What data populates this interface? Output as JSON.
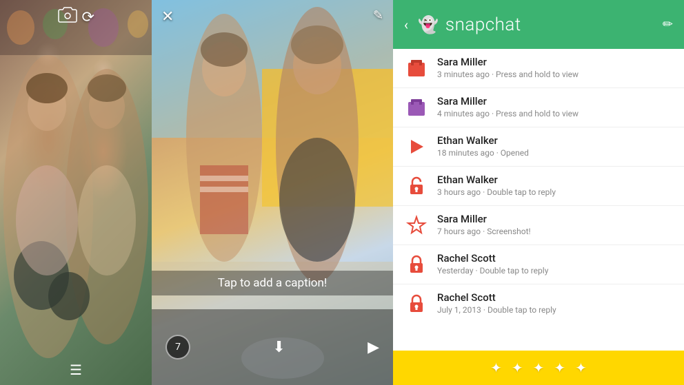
{
  "left_panel": {
    "top_icon": "📷",
    "bottom_icon": "☰"
  },
  "mid_panel": {
    "close_icon": "✕",
    "edit_icon": "✎",
    "caption": "Tap to add a caption!",
    "timer": "7",
    "download_icon": "⬇",
    "send_icon": "▶"
  },
  "right_panel": {
    "header": {
      "back": "‹",
      "ghost": "👻",
      "title": "snapchat",
      "compose": "✏"
    },
    "inbox": [
      {
        "icon": "📦",
        "icon_color": "#e74c3c",
        "name": "Sara Miller",
        "time": "3 minutes ago · Press and hold to view"
      },
      {
        "icon": "📦",
        "icon_color": "#9b59b6",
        "name": "Sara Miller",
        "time": "4 minutes ago · Press and hold to view"
      },
      {
        "icon": "▶",
        "icon_color": "#e74c3c",
        "name": "Ethan Walker",
        "time": "18 minutes ago · Opened"
      },
      {
        "icon": "🔓",
        "icon_color": "#e74c3c",
        "name": "Ethan Walker",
        "time": "3 hours ago · Double tap to reply"
      },
      {
        "icon": "★",
        "icon_color": "#e74c3c",
        "name": "Sara Miller",
        "time": "7 hours ago · Screenshot!"
      },
      {
        "icon": "🔒",
        "icon_color": "#e74c3c",
        "name": "Rachel Scott",
        "time": "Yesterday · Double tap to reply"
      },
      {
        "icon": "🔒",
        "icon_color": "#e74c3c",
        "name": "Rachel Scott",
        "time": "July 1, 2013 · Double tap to reply"
      }
    ],
    "yellow_bar_stars": [
      "✦",
      "✦",
      "✦",
      "✦",
      "✦"
    ]
  }
}
